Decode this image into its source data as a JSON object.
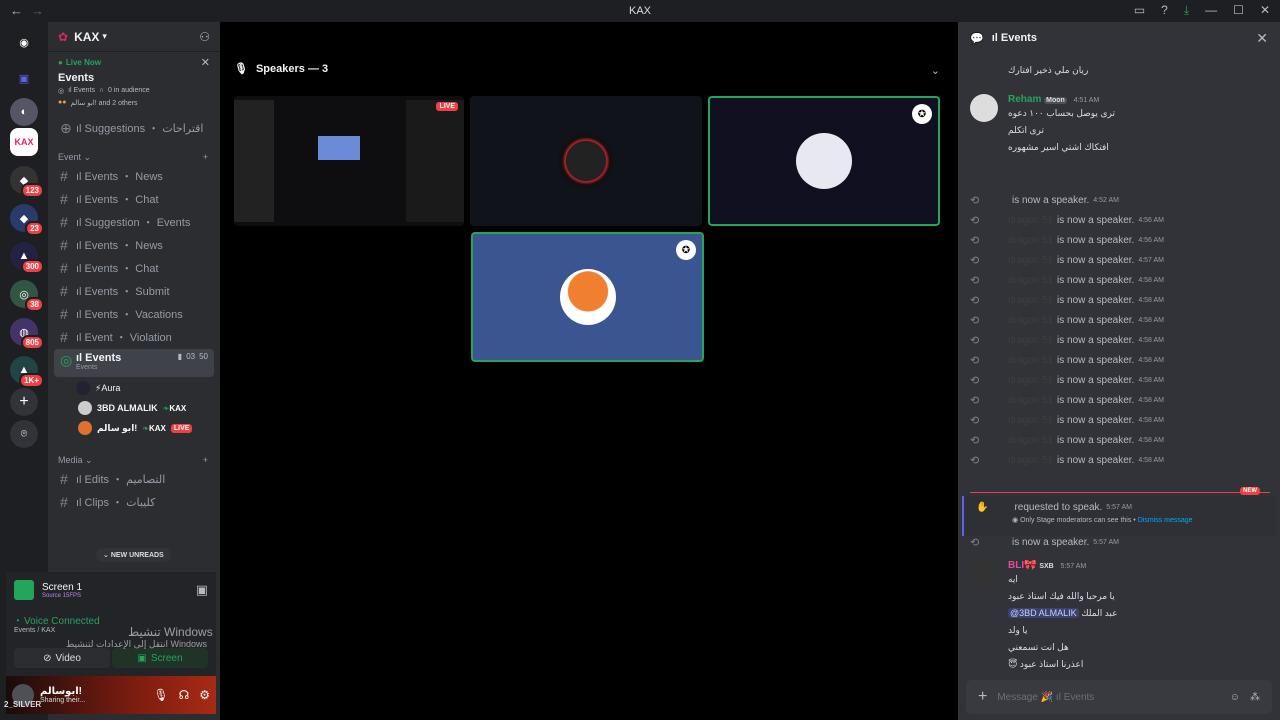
{
  "window": {
    "title": "KAX"
  },
  "server": {
    "name": "KAX"
  },
  "live_card": {
    "status": "Live Now",
    "event_title": "Events",
    "stage_name": "ıl Events",
    "audience": "0 in audience",
    "speakers_text": "ابو سالم! and 2 others"
  },
  "channels_top": [
    {
      "label": "ıl Suggestions ・ اقتراحات"
    }
  ],
  "categories": {
    "event": "Event",
    "media": "Media"
  },
  "event_channels": [
    {
      "label": "ıl Events ・ News"
    },
    {
      "label": "ıl Events ・ Chat"
    },
    {
      "label": "ıl Suggestion ・ Events"
    },
    {
      "label": "ıl Events ・ News"
    },
    {
      "label": "ıl Events ・ Chat"
    },
    {
      "label": "ıl Events ・ Submit"
    },
    {
      "label": "ıl Events ・ Vacations"
    },
    {
      "label": "ıl Event ・ Violation"
    }
  ],
  "active_stage": {
    "label": "ıl Events",
    "sub": "Events",
    "cam": "03",
    "count": "50"
  },
  "voice_users": [
    {
      "name": "⚡Aura",
      "tag": ""
    },
    {
      "name": "3BD ALMALIK",
      "tag": "KAX"
    },
    {
      "name": "ابو سالم!",
      "tag": "KAX",
      "live": "LIVE"
    }
  ],
  "media_channels": [
    {
      "label": "ıl Edits ・ التصاميم"
    },
    {
      "label": "ıl Clips ・ كليبات"
    }
  ],
  "new_unreads": "NEW UNREADS",
  "stream": {
    "title": "Screen 1",
    "sub": "Source 15FPS"
  },
  "voice": {
    "status": "Voice Connected",
    "channel": "Events / KAX",
    "video_btn": "Video",
    "screen_btn": "Screen"
  },
  "user": {
    "name": "ابوسالم!",
    "status": "Sharing their...",
    "under": "2_SILVER"
  },
  "watermark": {
    "line1": "تنشيط Windows",
    "line2": "انتقل إلى الإعدادات لتنشيط Windows"
  },
  "server_badges": [
    "123",
    "23",
    "300",
    "38",
    "805",
    "1K+"
  ],
  "stage": {
    "heading": "Speakers — 3",
    "live_badge": "LIVE"
  },
  "chat": {
    "title": "ıl Events",
    "top_line": "ريان ملي ذخير افتارك",
    "reham": {
      "name": "Reham",
      "badge": "Moon",
      "time": "4:51 AM",
      "lines": [
        "ترى يوصل بحساب ١٠٠ دعوه",
        "ترى اتكلم",
        "افتكاك اشتي اسير مشهوره"
      ]
    },
    "speaker_events": [
      {
        "name": "",
        "time": "4:52 AM"
      },
      {
        "name": "dragon 51",
        "time": "4:56 AM"
      },
      {
        "name": "dragon 51",
        "time": "4:56 AM"
      },
      {
        "name": "dragon 51",
        "time": "4:57 AM"
      },
      {
        "name": "dragon 51",
        "time": "4:58 AM"
      },
      {
        "name": "dragon 51",
        "time": "4:58 AM"
      },
      {
        "name": "dragon 51",
        "time": "4:58 AM"
      },
      {
        "name": "dragon 51",
        "time": "4:58 AM"
      },
      {
        "name": "dragon 51",
        "time": "4:58 AM"
      },
      {
        "name": "dragon 51",
        "time": "4:58 AM"
      },
      {
        "name": "dragon 51",
        "time": "4:58 AM"
      },
      {
        "name": "dragon 51",
        "time": "4:58 AM"
      },
      {
        "name": "dragon 51",
        "time": "4:58 AM"
      },
      {
        "name": "dragon 51",
        "time": "4:58 AM"
      }
    ],
    "speaker_suffix": "is now a speaker.",
    "new_tag": "NEW",
    "request": {
      "text": "requested to speak.",
      "time": "5:57 AM",
      "note": "Only Stage moderators can see this •",
      "dismiss": "Dismiss message"
    },
    "speaker_after": {
      "time": "5:57 AM"
    },
    "bli": {
      "name": "BLI🎀",
      "badge": "SXB",
      "time": "5:57 AM",
      "lines": [
        "ايه",
        "يا مرحبا والله فيك استاذ عبود",
        "عبد الملك",
        "يا ولد",
        "هل انت تسمعني",
        "اعذرنا استاذ عبود"
      ],
      "mention": "@3BD ALMALIK"
    },
    "composer_placeholder": "Message 🎉 ıl Events"
  },
  "colors": {
    "accent": "#5865f2",
    "live": "#f23f43",
    "green": "#23a55a",
    "reham": "#23a55a",
    "bli": "#eb459e"
  }
}
